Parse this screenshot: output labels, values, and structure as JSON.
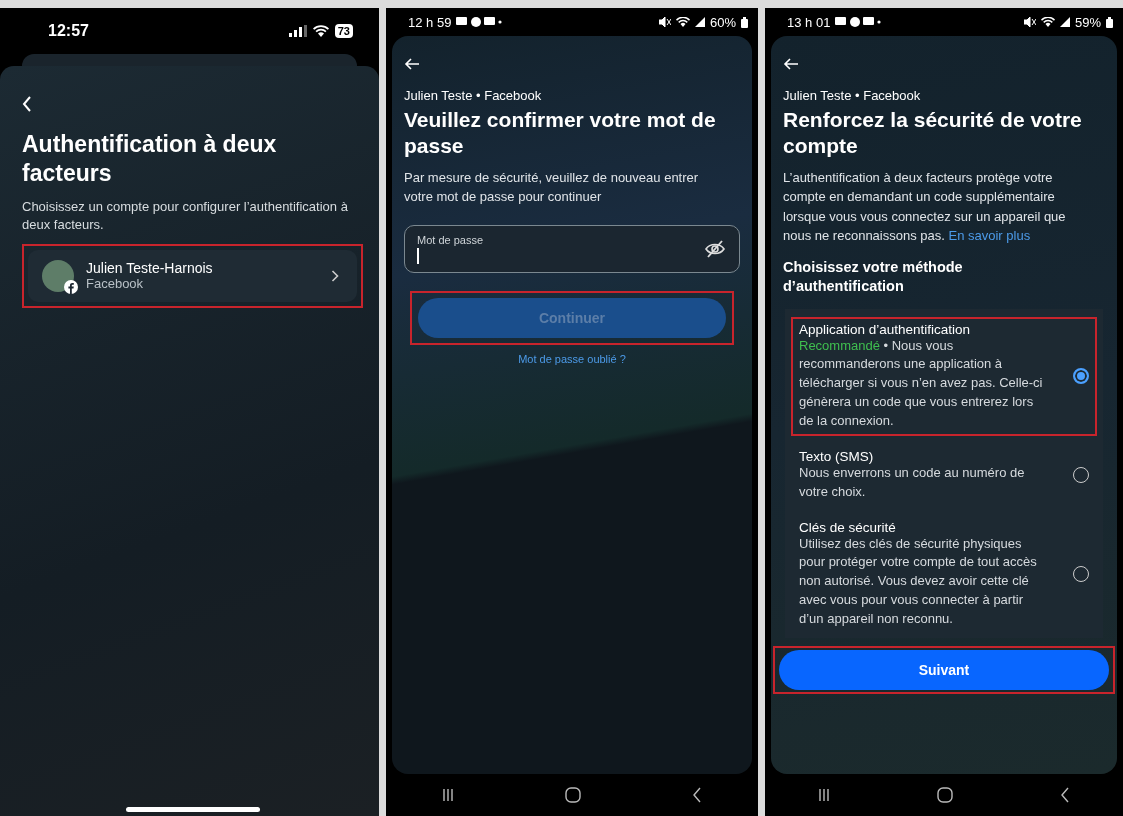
{
  "screens": [
    {
      "kind": "account-picker",
      "status_bar": {
        "time": "12:57",
        "battery": "73"
      },
      "title": "Authentification à deux facteurs",
      "subtitle": "Choisissez un compte pour configurer l’authentification à deux facteurs.",
      "accounts": [
        {
          "name": "Julien Teste-Harnois",
          "service": "Facebook",
          "highlighted": true
        }
      ]
    },
    {
      "kind": "password",
      "status_bar": {
        "time": "12 h 59",
        "battery": "60%"
      },
      "account_line": "Julien Teste • Facebook",
      "title": "Veuillez confirmer votre mot de passe",
      "description": "Par mesure de sécurité, veuillez de nouveau entrer votre mot de passe pour continuer",
      "password_field": {
        "label": "Mot de passe"
      },
      "continue_button": {
        "label": "Continuer",
        "disabled": true,
        "highlighted": true
      },
      "forgot_link": "Mot de passe oublié ?"
    },
    {
      "kind": "method-picker",
      "status_bar": {
        "time": "13 h 01",
        "battery": "59%"
      },
      "account_line": "Julien Teste • Facebook",
      "title": "Renforcez la sécurité de votre compte",
      "description": "L’authentification à deux facteurs protège votre compte en demandant un code supplémentaire lorsque vous vous connectez sur un appareil que nous ne reconnaissons pas.",
      "learn_more_link": "En savoir plus",
      "section_title": "Choisissez votre méthode d’authentification",
      "methods": [
        {
          "title": "Application d’authentification",
          "badge": "Recommandé",
          "description": " • Nous vous recommanderons une application à télécharger si vous n’en avez pas. Celle-ci génèrera un code que vous entrerez lors de la connexion.",
          "selected": true,
          "highlighted": true
        },
        {
          "title": "Texto (SMS)",
          "description": "Nous enverrons un code au numéro de votre choix.",
          "selected": false,
          "highlighted": false
        },
        {
          "title": "Clés de sécurité",
          "description": "Utilisez des clés de sécurité physiques pour protéger votre compte de tout accès non autorisé. Vous devez avoir cette clé avec vous pour vous connecter à partir d’un appareil non reconnu.",
          "selected": false,
          "highlighted": false
        }
      ],
      "next_button": {
        "label": "Suivant",
        "highlighted": true
      }
    }
  ]
}
